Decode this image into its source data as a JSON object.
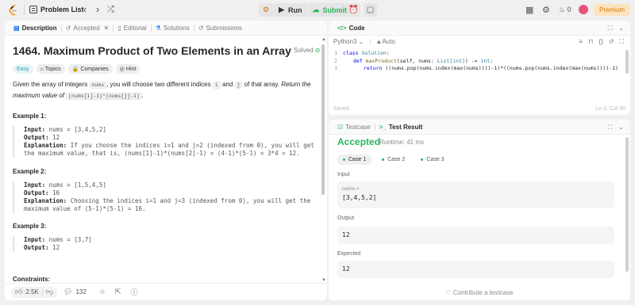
{
  "nav": {
    "problem_list": "Problem List",
    "run": "Run",
    "submit": "Submit",
    "streak": "0",
    "premium": "Premium"
  },
  "left_tabs": [
    {
      "label": "Description"
    },
    {
      "label": "Accepted"
    },
    {
      "label": "Editorial"
    },
    {
      "label": "Solutions"
    },
    {
      "label": "Submissions"
    }
  ],
  "problem": {
    "title": "1464. Maximum Product of Two Elements in an Array",
    "status": "Solved",
    "chips": [
      "Easy",
      "Topics",
      "Companies",
      "Hint"
    ],
    "desc_1": "Given the array of integers ",
    "desc_nums": "nums",
    "desc_2": ", you will choose two different indices ",
    "desc_i": "i",
    "desc_3": " and ",
    "desc_j": "j",
    "desc_4": " of that array. ",
    "desc_5": "Return the maximum value of ",
    "desc_expr": "(nums[i]-1)*(nums[j]-1)",
    "desc_6": "."
  },
  "examples": [
    {
      "title": "Example 1:",
      "input": "nums = [3,4,5,2]",
      "output": "12",
      "explanation": "If you choose the indices i=1 and j=2 (indexed from 0), you will get the maximum value, that is, (nums[1]-1)*(nums[2]-1) = (4-1)*(5-1) = 3*4 = 12."
    },
    {
      "title": "Example 2:",
      "input": "nums = [1,5,4,5]",
      "output": "16",
      "explanation": "Choosing the indices i=1 and j=3 (indexed from 0), you will get the maximum value of (5-1)*(5-1) = 16."
    },
    {
      "title": "Example 3:",
      "input": "nums = [3,7]",
      "output": "12"
    }
  ],
  "labels": {
    "input": "Input:",
    "output": "Output:",
    "explanation": "Explanation:",
    "constraints": "Constraints:"
  },
  "footer": {
    "likes": "2.5K",
    "comments": "132"
  },
  "code_panel": {
    "tab": "Code",
    "language": "Python3",
    "auto": "Auto",
    "line1_kw": "class",
    "line1_name": "Solution",
    "line2_kw": "def",
    "line2_fn": "maxProduct",
    "line2_params": "(self, nums: ",
    "line2_type": "List[int]",
    "line2_ret": ") -> ",
    "line2_rtype": "int",
    "line2_end": ":",
    "line3_kw": "return",
    "line3_body": " ((nums.pop(nums.index(max(nums))))-1)*((nums.pop(nums.index(max(nums))))-1)",
    "saved": "Saved",
    "position": "Ln 3, Col 90"
  },
  "result_panel": {
    "tab_testcase": "Testcase",
    "tab_result": "Test Result",
    "status": "Accepted",
    "runtime": "Runtime: 41 ms",
    "cases": [
      "Case 1",
      "Case 2",
      "Case 3"
    ],
    "input_label": "Input",
    "var_name": "nums =",
    "input_value": "[3,4,5,2]",
    "output_label": "Output",
    "output_value": "12",
    "expected_label": "Expected",
    "expected_value": "12",
    "contribute": "Contribute a testcase"
  },
  "colors": {
    "accent_green": "#2db55d",
    "easy": "#1ea4b4",
    "premium_bg": "#fde4c0",
    "premium_fg": "#d97706"
  }
}
